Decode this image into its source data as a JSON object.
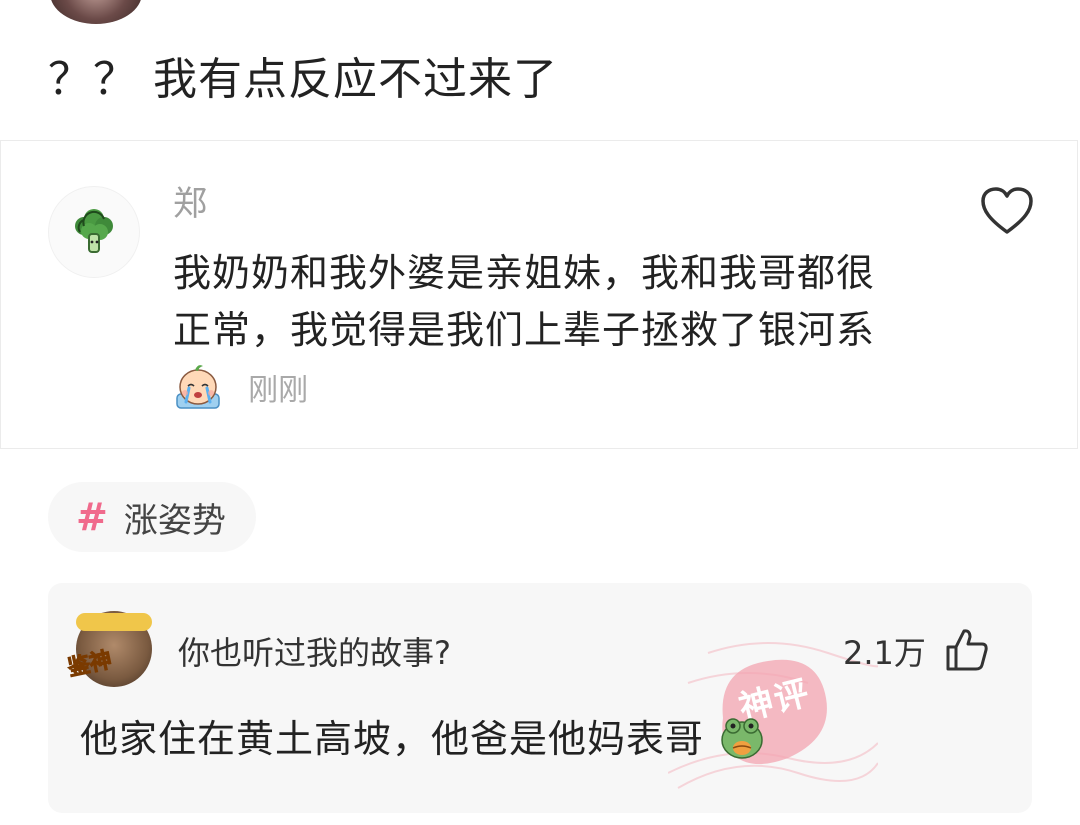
{
  "post": {
    "text": "？？ 我有点反应不过来了"
  },
  "quoted_comment": {
    "author": "郑",
    "text": "我奶奶和我外婆是亲姐妹，我和我哥都很正常，我觉得是我们上辈子拯救了银河系",
    "emoji": "crying-face-emoji",
    "time": "刚刚",
    "like_icon": "heart-outline-icon"
  },
  "topic": {
    "hash_symbol": "#",
    "label": "涨姿势"
  },
  "featured_comment": {
    "author": "你也听过我的故事?",
    "likes": "2.1万",
    "text": "他家住在黄土高坡，他爸是他妈表哥",
    "emoji": "frog-face-emoji",
    "badge": "鉴神",
    "stamp": "神评",
    "like_icon": "thumbs-up-outline-icon"
  },
  "colors": {
    "topic_hash": "#f06a8c",
    "stamp": "#f08a98",
    "muted_text": "#a0a0a0",
    "card_bg": "#f7f7f7"
  }
}
